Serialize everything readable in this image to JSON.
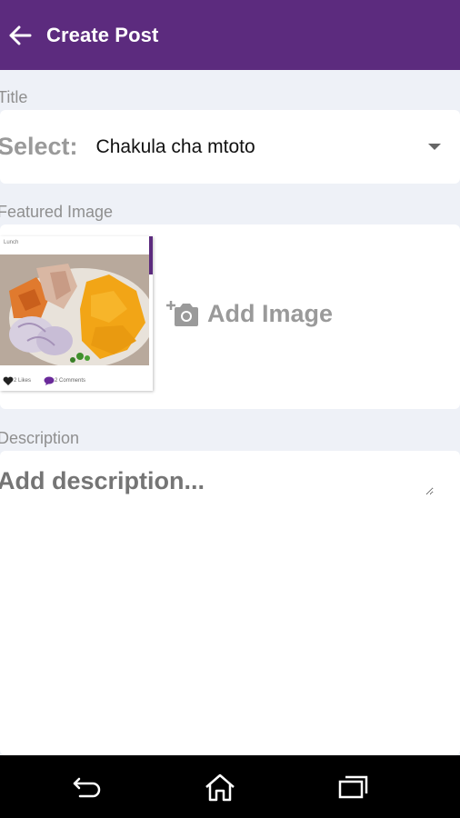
{
  "header": {
    "title": "Create Post",
    "back_icon": "arrow-left-icon",
    "background": "#5c2b7e"
  },
  "title_section": {
    "label": "Title",
    "select_label": "Select:",
    "select_value": "Chakula cha mtoto"
  },
  "featured_image": {
    "label": "Featured Image",
    "thumbnail": {
      "caption": "Lunch",
      "likes": "2 Likes",
      "comments": "2 Comments"
    },
    "add_image_label": "Add Image"
  },
  "description": {
    "label": "Description",
    "placeholder": "Add description..."
  },
  "nav_bar": {
    "back": "back-icon",
    "home": "home-icon",
    "recents": "recents-icon"
  }
}
